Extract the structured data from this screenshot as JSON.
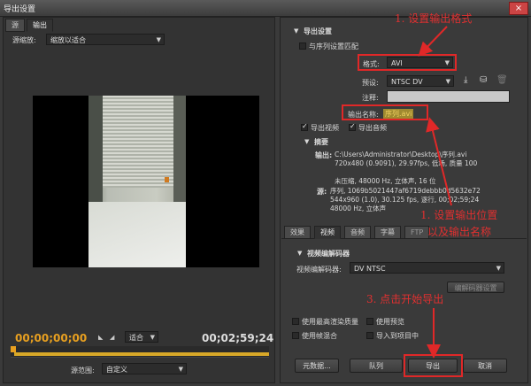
{
  "window": {
    "title": "导出设置",
    "close_glyph": "×"
  },
  "source_tabs": [
    "源",
    "输出"
  ],
  "source_scaling": {
    "label": "源缩放:",
    "value": "缩放以适合"
  },
  "timecode_start": "00;00;00;00",
  "timecode_end": "00;02;59;24",
  "fit_select": "适合",
  "source_range": {
    "label": "源范围:",
    "value": "自定义"
  },
  "export_settings": {
    "section_title": "导出设置",
    "match_sequence_label": "与序列设置匹配",
    "format_label": "格式:",
    "format_value": "AVI",
    "preset_label": "预设:",
    "preset_value": "NTSC DV",
    "comment_label": "注释:",
    "output_name_label": "输出名称:",
    "output_name_value": "序列.avi",
    "export_video_label": "导出视频",
    "export_audio_label": "导出音频"
  },
  "summary": {
    "title": "摘要",
    "output_label": "输出:",
    "output_lines": [
      "C:\\Users\\Administrator\\Desktop\\序列.avi",
      "720x480 (0.9091), 29.97fps, 低场, 质量 100",
      "",
      "未压缩, 48000 Hz, 立体声, 16 位"
    ],
    "source_label": "源:",
    "source_lines": [
      "序列, 1069b5021447af6719debbb0d5632e72",
      "544x960 (1.0), 30.125 fps, 逐行, 00;02;59;24",
      "48000 Hz, 立体声"
    ]
  },
  "settings_tabs": [
    "效果",
    "视频",
    "音频",
    "字幕",
    "FTP"
  ],
  "video_codec": {
    "section_title": "视频编解码器",
    "label": "视频编解码器:",
    "value": "DV NTSC",
    "settings_button": "编解码器设置"
  },
  "bottom_options": [
    "使用最高渲染质量",
    "使用预览",
    "使用帧混合",
    "导入到项目中"
  ],
  "buttons": {
    "metadata": "元数据...",
    "queue": "队列",
    "export": "导出",
    "cancel": "取消"
  },
  "annotations": {
    "step1": "1. 设置输出格式",
    "step2_line1": "1. 设置输出位置",
    "step2_line2": "以及输出名称",
    "step3": "3. 点击开始导出"
  },
  "colors": {
    "annotation": "#e02828",
    "timecode": "#e8a020",
    "highlight": "#c8a030"
  }
}
